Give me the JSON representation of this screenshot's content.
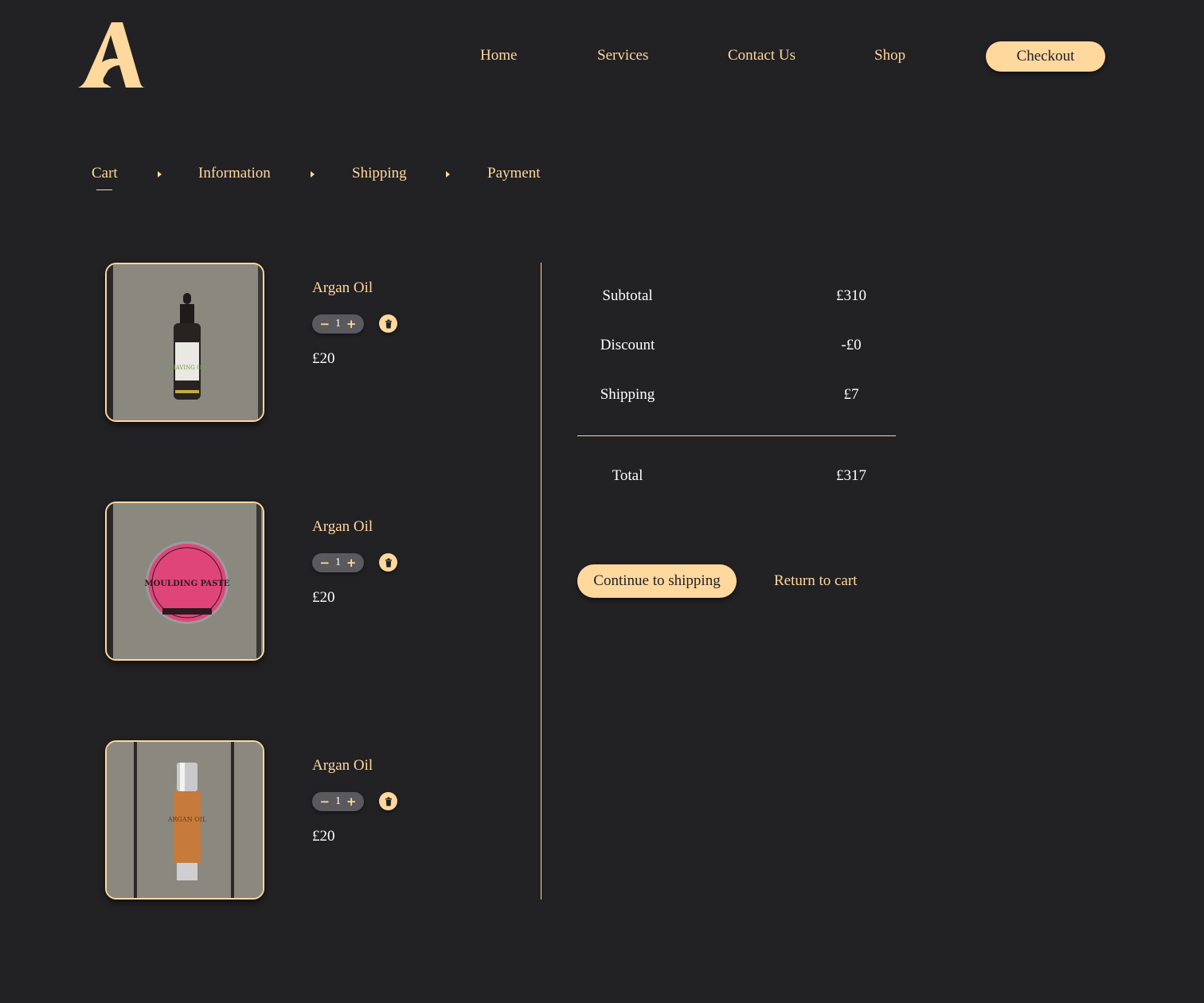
{
  "header": {
    "logo_icon": "letter-a-logo-icon",
    "nav": [
      {
        "label": "Home"
      },
      {
        "label": "Services"
      },
      {
        "label": "Contact Us"
      },
      {
        "label": "Shop"
      }
    ],
    "checkout_label": "Checkout"
  },
  "breadcrumb": {
    "steps": [
      {
        "label": "Cart",
        "active": true
      },
      {
        "label": "Information",
        "active": false
      },
      {
        "label": "Shipping",
        "active": false
      },
      {
        "label": "Payment",
        "active": false
      }
    ],
    "separator_icon": "caret-right-icon"
  },
  "cart": {
    "items": [
      {
        "name": "Argan Oil",
        "quantity": "1",
        "price": "£20",
        "image": "shaving-oil-dropper-bottle",
        "image_label": "SHAVING OIL"
      },
      {
        "name": "Argan Oil",
        "quantity": "1",
        "price": "£20",
        "image": "moulding-paste-tin",
        "image_label": "MOULDING PASTE"
      },
      {
        "name": "Argan Oil",
        "quantity": "1",
        "price": "£20",
        "image": "argan-oil-pump-bottle",
        "image_label": "ARGAN OIL"
      }
    ],
    "minus_icon": "minus-icon",
    "plus_icon": "plus-icon",
    "delete_icon": "trash-icon"
  },
  "summary": {
    "rows": [
      {
        "label": "Subtotal",
        "value": "£310"
      },
      {
        "label": "Discount",
        "value": "-£0"
      },
      {
        "label": "Shipping",
        "value": "£7"
      }
    ],
    "total": {
      "label": "Total",
      "value": "£317"
    },
    "continue_label": "Continue to shipping",
    "return_label": "Return to cart"
  },
  "colors": {
    "background": "#222124",
    "accent": "#ffd89e",
    "text": "#ffffff"
  }
}
